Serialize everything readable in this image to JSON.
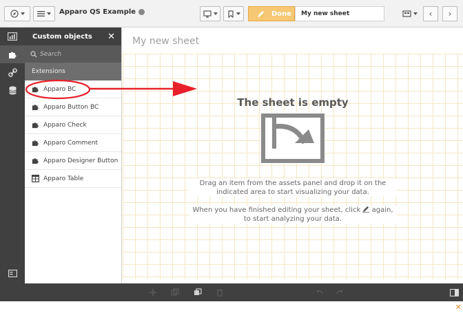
{
  "toolbar": {
    "app_title": "Apparo QS Example",
    "done_label": "Done",
    "sheet_name": "My new sheet"
  },
  "panel": {
    "title": "Custom objects",
    "search_placeholder": "Search",
    "section_label": "Extensions",
    "items": [
      {
        "label": "Apparo BC",
        "icon": "puzzle-icon"
      },
      {
        "label": "Apparo Button BC",
        "icon": "puzzle-icon"
      },
      {
        "label": "Apparo Check",
        "icon": "puzzle-icon"
      },
      {
        "label": "Apparo Comment",
        "icon": "puzzle-icon"
      },
      {
        "label": "Apparo Designer Button",
        "icon": "puzzle-icon"
      },
      {
        "label": "Apparo Table",
        "icon": "table-icon"
      }
    ]
  },
  "sheet": {
    "title": "My new sheet",
    "empty_title": "The sheet is empty",
    "hint_drag": "Drag an item from the assets panel and drop it on the indicated area to start visualizing your data.",
    "hint_done_before": "When you have finished editing your sheet, click",
    "hint_done_after": "again, to start analyzing your data."
  },
  "colors": {
    "rail": "#404040",
    "done_accent": "#f7c873",
    "annotation_red": "#e8202a",
    "grid_line": "#f6e6c4"
  }
}
